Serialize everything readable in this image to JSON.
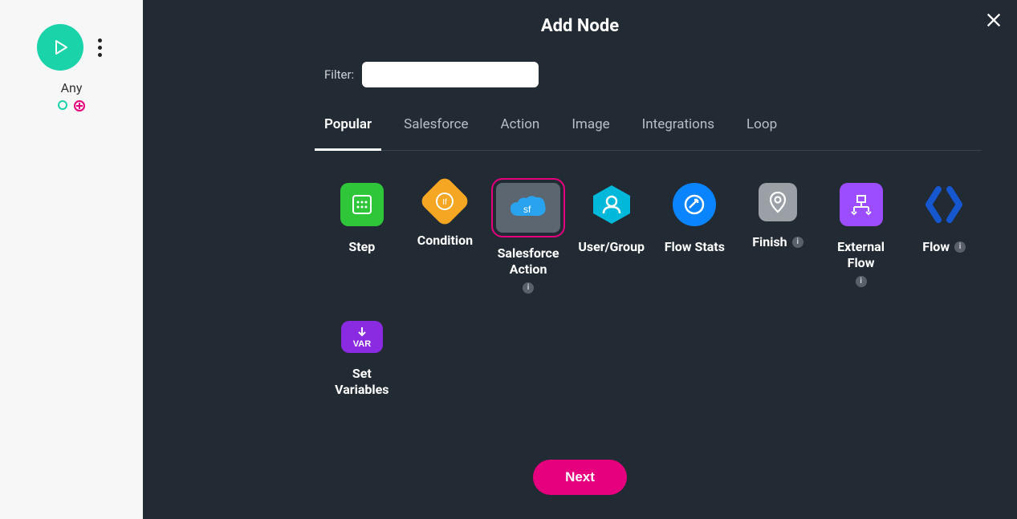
{
  "sidebar": {
    "start_label": "Any"
  },
  "modal": {
    "title": "Add Node",
    "filter_label": "Filter:",
    "filter_value": "",
    "tabs": [
      {
        "label": "Popular",
        "active": true
      },
      {
        "label": "Salesforce",
        "active": false
      },
      {
        "label": "Action",
        "active": false
      },
      {
        "label": "Image",
        "active": false
      },
      {
        "label": "Integrations",
        "active": false
      },
      {
        "label": "Loop",
        "active": false
      }
    ],
    "nodes": [
      {
        "label": "Step",
        "info": false,
        "selected": false
      },
      {
        "label": "Condition",
        "info": false,
        "selected": false
      },
      {
        "label": "Salesforce Action",
        "info": true,
        "selected": true
      },
      {
        "label": "User/Group",
        "info": false,
        "selected": false
      },
      {
        "label": "Flow Stats",
        "info": false,
        "selected": false
      },
      {
        "label": "Finish",
        "info": true,
        "selected": false
      },
      {
        "label": "External Flow",
        "info": true,
        "selected": false
      },
      {
        "label": "Flow",
        "info": true,
        "selected": false
      },
      {
        "label": "Set Variables",
        "info": false,
        "selected": false
      }
    ],
    "next_label": "Next"
  }
}
